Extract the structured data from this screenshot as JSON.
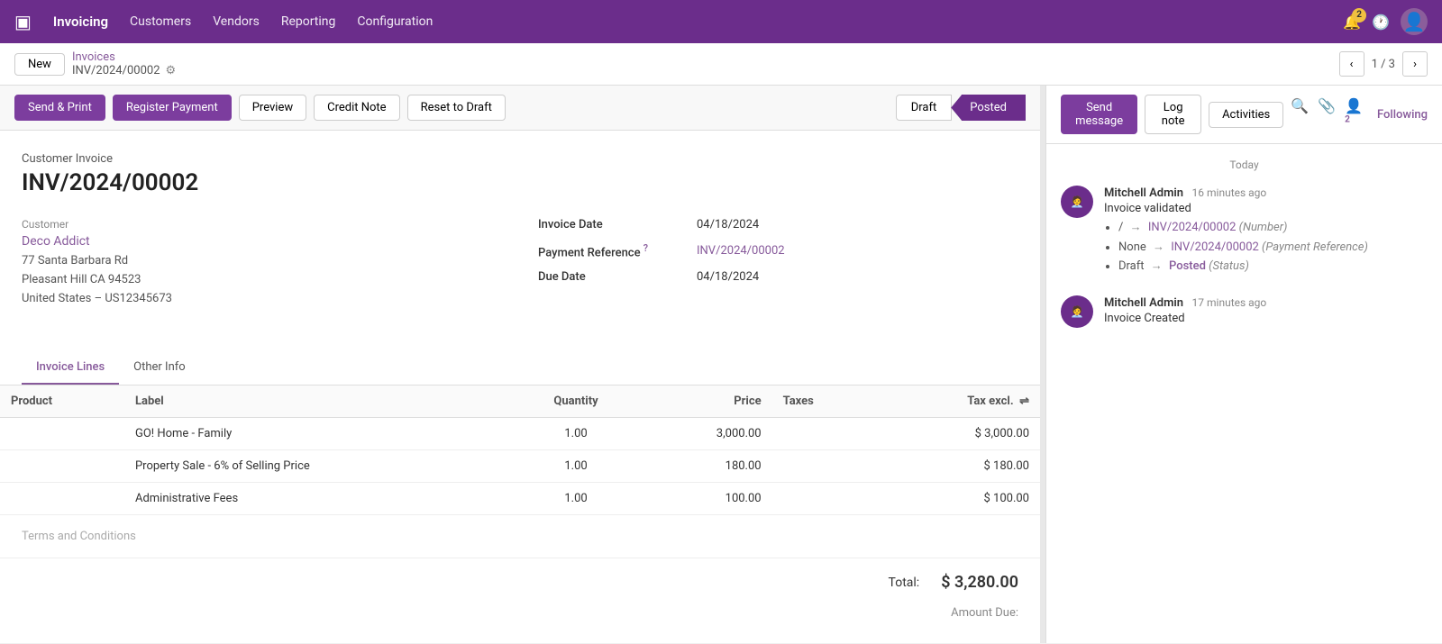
{
  "app": {
    "brand": "Invoicing",
    "nav_items": [
      "Customers",
      "Vendors",
      "Reporting",
      "Configuration"
    ]
  },
  "breadcrumb": {
    "new_label": "New",
    "parent": "Invoices",
    "current": "INV/2024/00002",
    "pagination": "1 / 3"
  },
  "toolbar": {
    "send_print": "Send & Print",
    "register_payment": "Register Payment",
    "preview": "Preview",
    "credit_note": "Credit Note",
    "reset_to_draft": "Reset to Draft",
    "status_draft": "Draft",
    "status_posted": "Posted"
  },
  "invoice": {
    "doc_type": "Customer Invoice",
    "number": "INV/2024/00002",
    "customer_label": "Customer",
    "customer_name": "Deco Addict",
    "address_line1": "77 Santa Barbara Rd",
    "address_line2": "Pleasant Hill CA 94523",
    "address_line3": "United States – US12345673",
    "invoice_date_label": "Invoice Date",
    "invoice_date": "04/18/2024",
    "payment_ref_label": "Payment Reference",
    "payment_ref_tooltip": "?",
    "payment_ref_value": "INV/2024/00002",
    "due_date_label": "Due Date",
    "due_date": "04/18/2024"
  },
  "tabs": [
    {
      "id": "invoice-lines",
      "label": "Invoice Lines",
      "active": true
    },
    {
      "id": "other-info",
      "label": "Other Info",
      "active": false
    }
  ],
  "table": {
    "headers": [
      "Product",
      "Label",
      "Quantity",
      "Price",
      "Taxes",
      "Tax excl."
    ],
    "rows": [
      {
        "product": "",
        "label": "GO! Home - Family",
        "quantity": "1.00",
        "price": "3,000.00",
        "taxes": "",
        "tax_excl": "$ 3,000.00"
      },
      {
        "product": "",
        "label": "Property Sale - 6% of Selling Price",
        "quantity": "1.00",
        "price": "180.00",
        "taxes": "",
        "tax_excl": "$ 180.00"
      },
      {
        "product": "",
        "label": "Administrative Fees",
        "quantity": "1.00",
        "price": "100.00",
        "taxes": "",
        "tax_excl": "$ 100.00"
      }
    ]
  },
  "terms_placeholder": "Terms and Conditions",
  "total_label": "Total:",
  "total_value": "$ 3,280.00",
  "amount_due_label": "Amount Due:",
  "chatter": {
    "send_message": "Send message",
    "log_note": "Log note",
    "activities": "Activities",
    "following": "Following",
    "date_header": "Today",
    "messages": [
      {
        "author": "Mitchell Admin",
        "time": "16 minutes ago",
        "action": "Invoice validated",
        "changes": [
          {
            "from": "/",
            "to": "INV/2024/00002",
            "field": "Number"
          },
          {
            "from": "None",
            "to": "INV/2024/00002",
            "field": "Payment Reference"
          },
          {
            "from": "Draft",
            "to": "Posted",
            "field": "Status"
          }
        ]
      },
      {
        "author": "Mitchell Admin",
        "time": "17 minutes ago",
        "action": "Invoice Created",
        "changes": []
      }
    ]
  }
}
